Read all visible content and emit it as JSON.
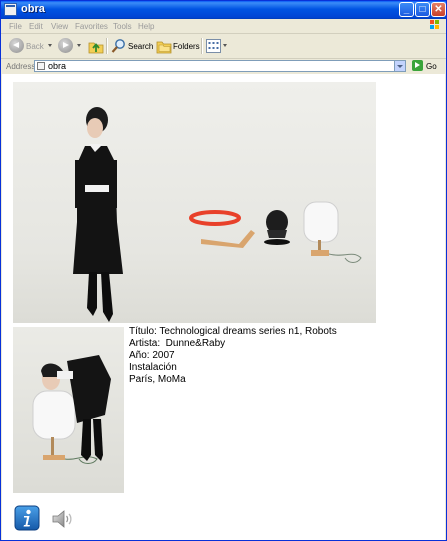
{
  "window": {
    "title": "obra",
    "controls": {
      "minimize": "_",
      "maximize": "□",
      "close": "✕"
    }
  },
  "menubar": {
    "items": [
      "File",
      "Edit",
      "View",
      "Favorites",
      "Tools",
      "Help"
    ],
    "logo_icon": "windows-flag-icon"
  },
  "toolbar": {
    "back_label": "Back",
    "search_label": "Search",
    "folders_label": "Folders"
  },
  "address": {
    "label": "Address",
    "value": "obra",
    "go_label": "Go"
  },
  "artwork": {
    "title_line": "Título: Technological dreams series n1, Robots",
    "artist_line": "Artista:  Dunne&Raby",
    "year_line": "Año: 2007",
    "type_line": "Instalación",
    "location_line": "París, MoMa"
  },
  "bottom_icons": [
    "info-icon",
    "speaker-icon"
  ],
  "colors": {
    "titlebar": "#0054e3",
    "window_bg": "#ece9d8",
    "robot_red": "#e8412a",
    "wood": "#d9a56e"
  }
}
